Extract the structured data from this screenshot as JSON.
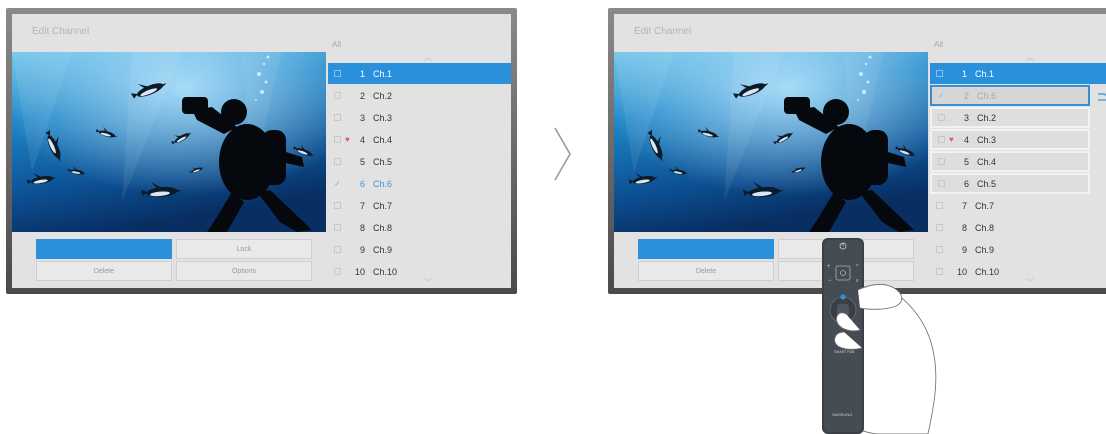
{
  "left_tv": {
    "title": "Edit Channel",
    "filter": "All",
    "buttons": {
      "lock": "Lock",
      "delete": "Delete",
      "options": "Options"
    },
    "channels": [
      {
        "num": "1",
        "name": "Ch.1",
        "state": "selected"
      },
      {
        "num": "2",
        "name": "Ch.2",
        "state": "normal"
      },
      {
        "num": "3",
        "name": "Ch.3",
        "state": "normal"
      },
      {
        "num": "4",
        "name": "Ch.4",
        "state": "favorite"
      },
      {
        "num": "5",
        "name": "Ch.5",
        "state": "normal"
      },
      {
        "num": "6",
        "name": "Ch.6",
        "state": "checked"
      },
      {
        "num": "7",
        "name": "Ch.7",
        "state": "normal"
      },
      {
        "num": "8",
        "name": "Ch.8",
        "state": "normal"
      },
      {
        "num": "9",
        "name": "Ch.9",
        "state": "normal"
      },
      {
        "num": "10",
        "name": "Ch.10",
        "state": "normal"
      }
    ]
  },
  "right_tv": {
    "title": "Edit Channel",
    "filter": "All",
    "buttons": {
      "delete": "Delete"
    },
    "channels": [
      {
        "num": "1",
        "name": "Ch.1",
        "state": "selected"
      },
      {
        "num": "2",
        "name": "Ch.6",
        "state": "moving"
      },
      {
        "num": "3",
        "name": "Ch.2",
        "state": "boxed"
      },
      {
        "num": "4",
        "name": "Ch.3",
        "state": "boxed-favorite"
      },
      {
        "num": "5",
        "name": "Ch.4",
        "state": "boxed"
      },
      {
        "num": "6",
        "name": "Ch.5",
        "state": "boxed"
      },
      {
        "num": "7",
        "name": "Ch.7",
        "state": "normal"
      },
      {
        "num": "8",
        "name": "Ch.8",
        "state": "normal"
      },
      {
        "num": "9",
        "name": "Ch.9",
        "state": "normal"
      },
      {
        "num": "10",
        "name": "Ch.10",
        "state": "normal"
      }
    ]
  },
  "remote": {
    "brand": "SAMSUNG",
    "label": "SMART HUB"
  },
  "colors": {
    "accent": "#2b90dc",
    "favorite": "#e3527a",
    "check": "#3e96dc"
  },
  "icons": {
    "next": "chevron-right-icon",
    "check": "check-icon",
    "favorite": "heart-icon"
  }
}
